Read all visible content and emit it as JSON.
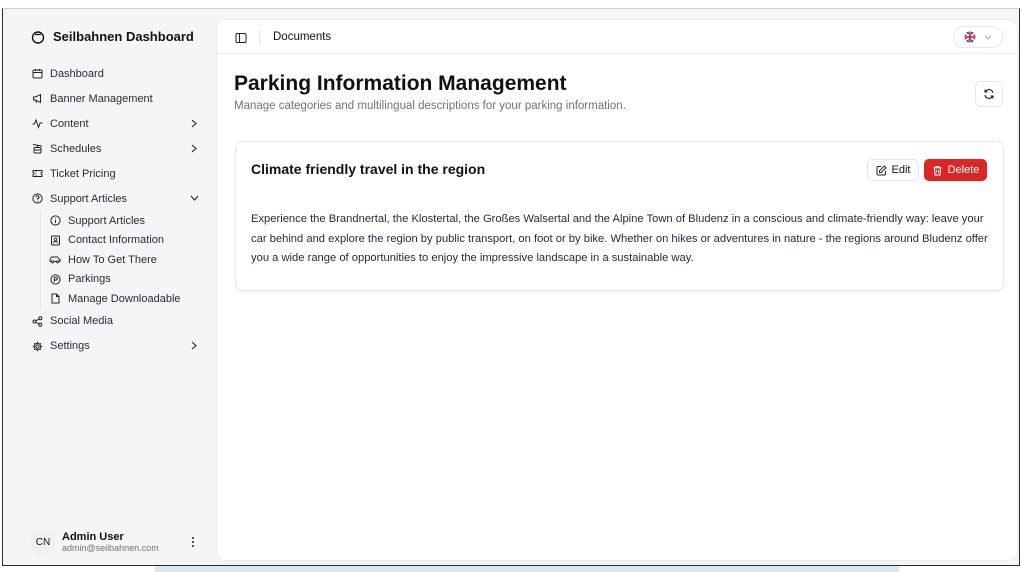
{
  "sidebar": {
    "brand": "Seilbahnen Dashboard",
    "items": [
      {
        "label": "Dashboard",
        "icon": "calendar-icon"
      },
      {
        "label": "Banner Management",
        "icon": "megaphone-icon"
      },
      {
        "label": "Content",
        "icon": "activity-icon"
      },
      {
        "label": "Schedules",
        "icon": "cable-car-icon"
      },
      {
        "label": "Ticket Pricing",
        "icon": "ticket-icon"
      },
      {
        "label": "Support Articles",
        "icon": "help-circle-icon"
      }
    ],
    "sub_items": [
      {
        "label": "Support Articles",
        "icon": "info-icon"
      },
      {
        "label": "Contact Information",
        "icon": "contact-icon"
      },
      {
        "label": "How To Get There",
        "icon": "car-icon"
      },
      {
        "label": "Parkings",
        "icon": "parking-icon"
      },
      {
        "label": "Manage Downloadable",
        "icon": "file-icon"
      }
    ],
    "bottom_items": [
      {
        "label": "Social Media",
        "icon": "share-icon"
      },
      {
        "label": "Settings",
        "icon": "settings-icon"
      }
    ]
  },
  "user": {
    "initials": "CN",
    "name": "Admin User",
    "email": "admin@seilbahnen.com"
  },
  "topbar": {
    "breadcrumb": "Documents"
  },
  "page": {
    "title": "Parking Information Management",
    "subtitle": "Manage categories and multilingual descriptions for your parking information."
  },
  "card": {
    "title": "Climate friendly travel in the region",
    "edit_label": "Edit",
    "delete_label": "Delete",
    "body": "Experience the Brandnertal, the Klostertal, the Großes Walsertal and the Alpine Town of Bludenz in a conscious and climate-friendly way: leave your car behind and explore the region by public transport, on foot or by bike. Whether on hikes or adventures in nature - the regions around Bludenz offer you a wide range of opportunities to enjoy the impressive landscape in a sustainable way."
  },
  "colors": {
    "delete": "#dc2626",
    "background": "#f5f5f6",
    "panel": "#ffffff"
  }
}
